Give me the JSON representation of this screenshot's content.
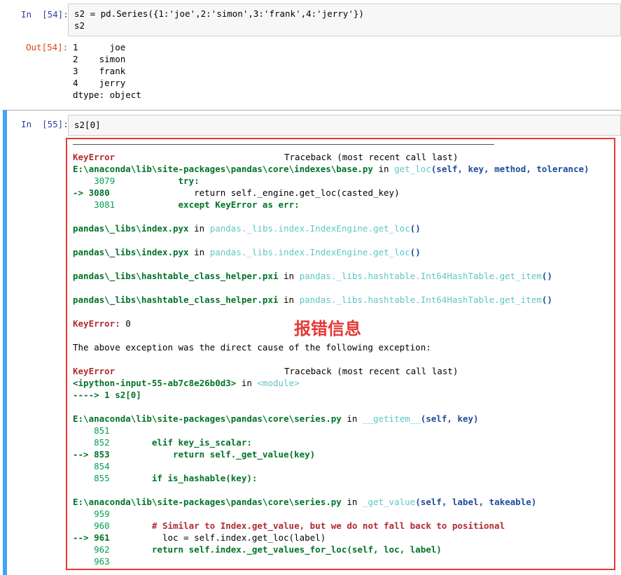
{
  "cell54": {
    "in_prompt": "In  [54]:",
    "code": [
      "s2 = pd.Series({1:'joe',2:'simon',3:'frank',4:'jerry'})",
      "s2"
    ],
    "out_prompt": "Out[54]:",
    "output": [
      "1      joe",
      "2    simon",
      "3    frank",
      "4    jerry",
      "dtype: object"
    ]
  },
  "cell55": {
    "in_prompt": "In  [55]:",
    "code": "s2[0]"
  },
  "annotation": "报错信息",
  "traceback": {
    "err1_name": "KeyError",
    "header_right": "Traceback (most recent call last)",
    "base_file": "E:\\anaconda\\lib\\site-packages\\pandas\\core\\indexes\\base.py",
    "in_word": " in ",
    "base_func": "get_loc",
    "base_args": "(self, key, method, tolerance)",
    "base_l1_no": "    3079",
    "base_l1_code": "            try:",
    "base_l2_no": "-> 3080",
    "base_l2_code": "                return self._engine.get_loc(casted_key)",
    "base_l3_no": "    3081",
    "base_l3_code": "            except KeyError as err:",
    "idx1_file": "pandas\\_libs\\index.pyx",
    "idx1_func": "pandas._libs.index.IndexEngine.get_loc",
    "idx2_file": "pandas\\_libs\\index.pyx",
    "idx2_func": "pandas._libs.index.IndexEngine.get_loc",
    "ht1_file": "pandas\\_libs\\hashtable_class_helper.pxi",
    "ht1_func": "pandas._libs.hashtable.Int64HashTable.get_item",
    "ht2_file": "pandas\\_libs\\hashtable_class_helper.pxi",
    "ht2_func": "pandas._libs.hashtable.Int64HashTable.get_item",
    "parens": "()",
    "keyerror_value": ": 0",
    "direct_cause": "The above exception was the direct cause of the following exception:",
    "err2_name": "KeyError",
    "header_right2": "Traceback (most recent call last)",
    "ipython_input": "<ipython-input-55-ab7c8e26b0d3>",
    "module_word": "<module>",
    "module_arrow": "----> 1 s2[0]",
    "series_file1": "E:\\anaconda\\lib\\site-packages\\pandas\\core\\series.py",
    "series_func1": "__getitem__",
    "series_args1": "(self, key)",
    "s1_851": "    851",
    "s1_852": "    852",
    "s1_852_code": "        elif key_is_scalar:",
    "s1_853": "--> 853",
    "s1_853_code": "            return self._get_value(key)",
    "s1_854": "    854",
    "s1_855": "    855",
    "s1_855_code": "        if is_hashable(key):",
    "series_file2": "E:\\anaconda\\lib\\site-packages\\pandas\\core\\series.py",
    "series_func2": "_get_value",
    "series_args2": "(self, label, takeable)",
    "s2_959": "    959",
    "s2_960": "    960",
    "s2_960_code": "        # Similar to Index.get_value, but we do not fall back to positional",
    "s2_961": "--> 961",
    "s2_961_code": "          loc = self.index.get_loc(label)",
    "s2_962": "    962",
    "s2_962_code": "        return self.index._get_values_for_loc(self, loc, label)",
    "s2_963": "    963"
  }
}
